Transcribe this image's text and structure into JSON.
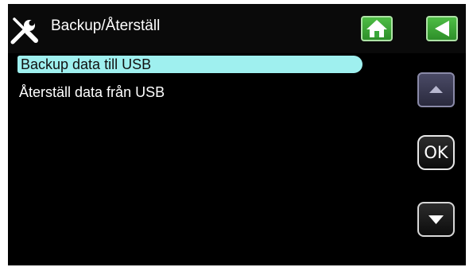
{
  "header": {
    "icon": "tools-icon",
    "title": "Backup/Återställ",
    "home_icon": "home-icon",
    "back_icon": "back-arrow-icon"
  },
  "menu": {
    "items": [
      {
        "label": "Backup data till USB",
        "selected": true
      },
      {
        "label": "Återställ data från USB",
        "selected": false
      }
    ]
  },
  "nav": {
    "up_icon": "arrow-up-icon",
    "ok_label": "OK",
    "down_icon": "arrow-down-icon"
  },
  "colors": {
    "screen_bg": "#000000",
    "selection": "#9ff0ef",
    "header_button": "#3aa83a",
    "text": "#ffffff"
  }
}
